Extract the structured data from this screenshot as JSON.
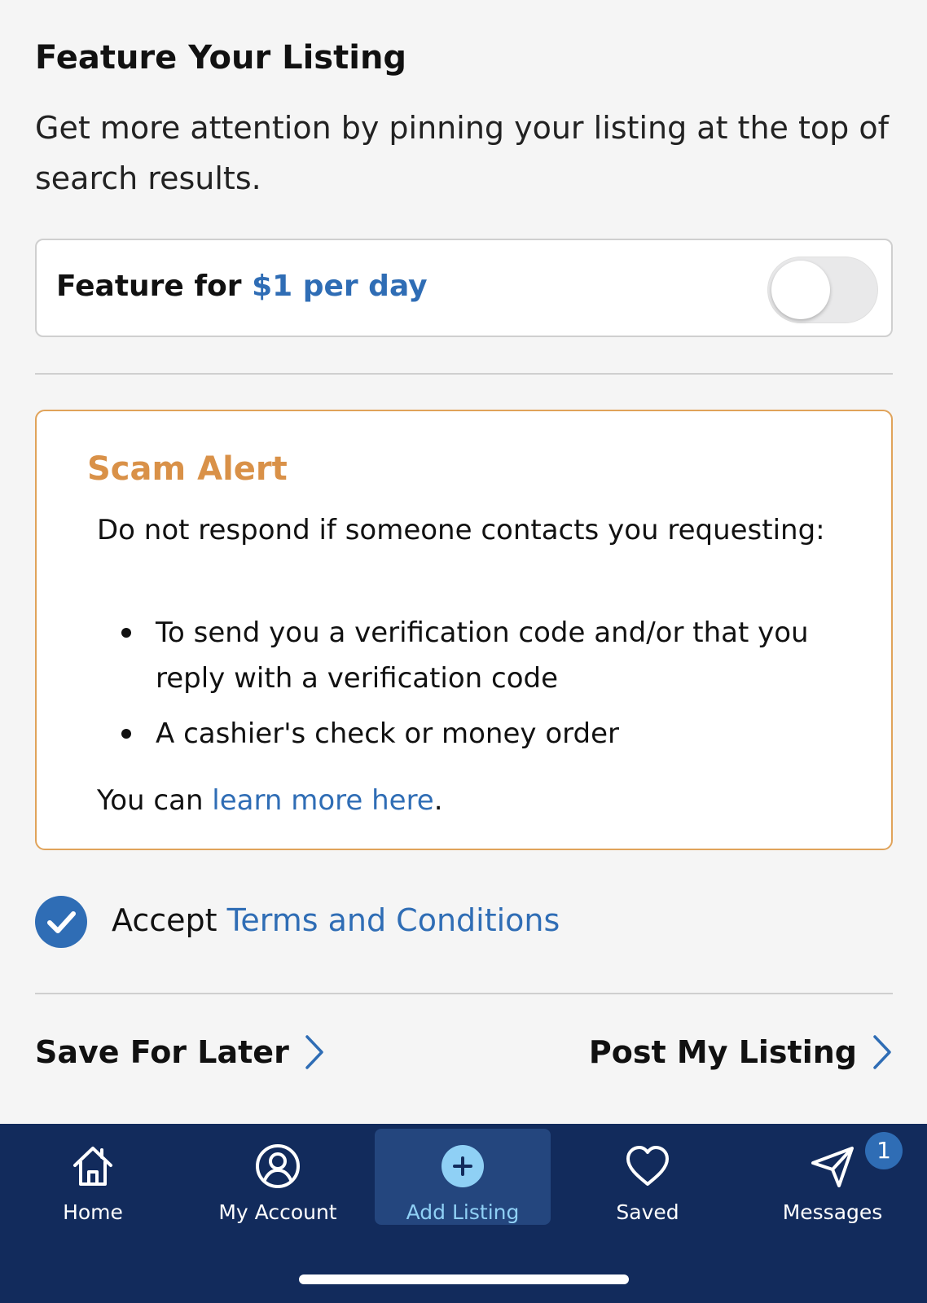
{
  "feature": {
    "title": "Feature Your Listing",
    "description": "Get more attention by pinning your listing at the top of search results.",
    "toggle_label": "Feature for ",
    "toggle_price": "$1 per day",
    "toggle_on": false
  },
  "scam_alert": {
    "title": "Scam Alert",
    "intro": "Do not respond if someone contacts you requesting:",
    "items": [
      "To send you a verification code and/or that you reply with a verification code",
      "A cashier's check or money order"
    ],
    "footer_prefix": "You can ",
    "footer_link": "learn more here",
    "footer_suffix": "."
  },
  "terms": {
    "checked": true,
    "label": "Accept",
    "link": "Terms and Conditions"
  },
  "actions": {
    "save_label": "Save For Later",
    "post_label": "Post My Listing"
  },
  "tabbar": {
    "items": [
      {
        "label": "Home",
        "icon": "home-icon"
      },
      {
        "label": "My Account",
        "icon": "account-icon"
      },
      {
        "label": "Add Listing",
        "icon": "add-icon",
        "active": true
      },
      {
        "label": "Saved",
        "icon": "heart-icon"
      },
      {
        "label": "Messages",
        "icon": "paper-plane-icon",
        "badge": "1"
      }
    ]
  },
  "colors": {
    "accent": "#2f6db5",
    "alert": "#d99148",
    "tabbar": "#122b5c",
    "active_label": "#8fd0f5"
  }
}
